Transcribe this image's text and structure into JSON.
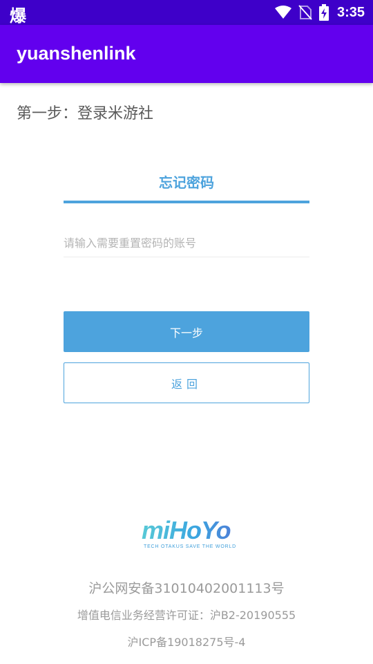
{
  "status_bar": {
    "left_glyph": "爆",
    "time": "3:35",
    "icons": [
      "wifi-icon",
      "no-sim-icon",
      "battery-charging-icon"
    ]
  },
  "app_bar": {
    "title": "yuanshenlink"
  },
  "step": {
    "title": "第一步：登录米游社"
  },
  "form": {
    "tab_label": "忘记密码",
    "account_placeholder": "请输入需要重置密码的账号",
    "account_value": "",
    "next_label": "下一步",
    "back_label": "返回"
  },
  "logo": {
    "text": "miHoYo",
    "tagline": "TECH OTAKUS SAVE THE WORLD"
  },
  "footer": {
    "line1": "沪公网安备31010402001113号",
    "line2": "增值电信业务经营许可证：沪B2-20190555",
    "line3": "沪ICP备19018275号-4"
  },
  "colors": {
    "status_bar": "#3e00c9",
    "app_bar": "#6200ee",
    "accent": "#4da3dd"
  }
}
